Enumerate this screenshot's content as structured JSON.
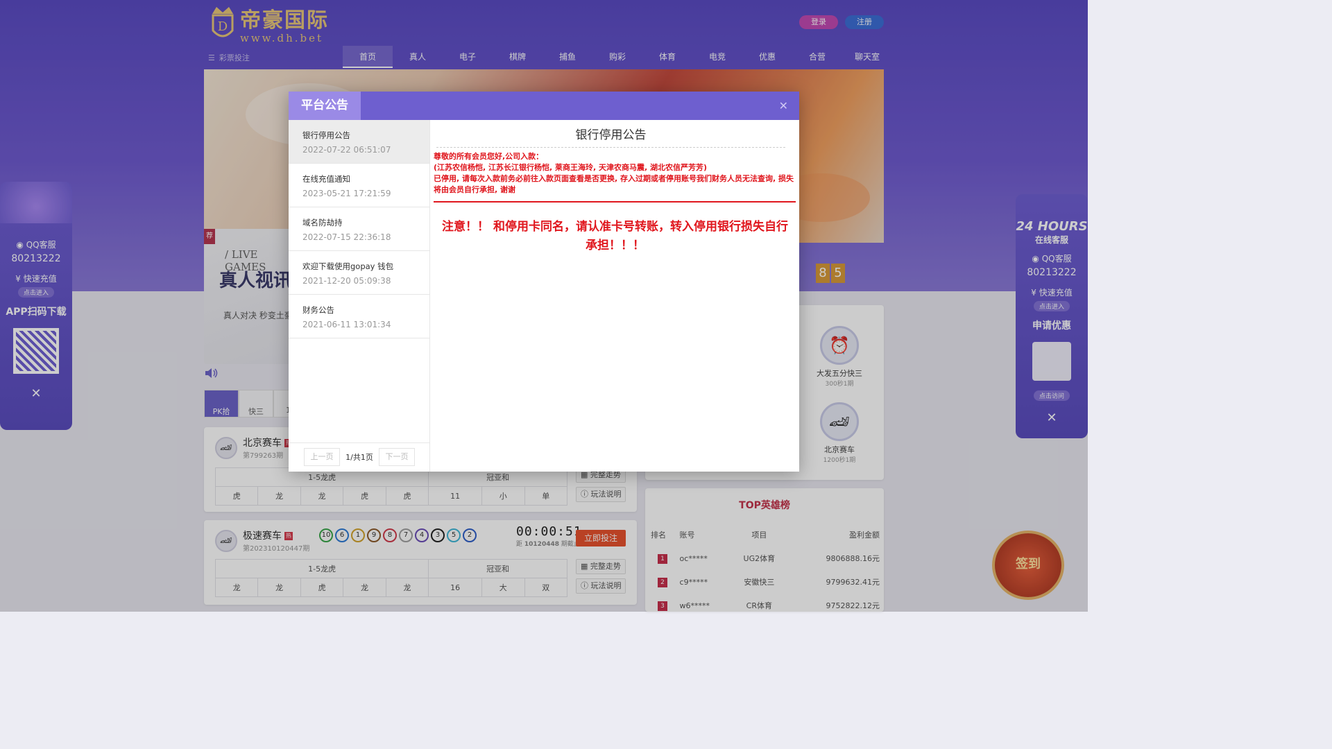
{
  "header": {
    "logo_cn": "帝豪国际",
    "logo_url": "www.dh.bet",
    "login": "登录",
    "register": "注册",
    "lottery_menu": "彩票投注",
    "nav": [
      "首页",
      "真人",
      "电子",
      "棋牌",
      "捕鱼",
      "购彩",
      "体育",
      "电竞",
      "优惠",
      "合营",
      "聊天室"
    ]
  },
  "live": {
    "rec": "荐",
    "sub": "/ LIVE GAMES",
    "title": "真人视讯",
    "desc": "真人对决 秒变土豪"
  },
  "cat_tabs": [
    "PK拾",
    "快三",
    "11"
  ],
  "games": [
    {
      "name": "北京赛车",
      "tag": "热",
      "period": "第799263期",
      "head": [
        "1-5龙虎",
        "冠亚和"
      ],
      "cells": [
        "虎",
        "龙",
        "龙",
        "虎",
        "虎",
        "11",
        "小",
        "单"
      ],
      "side": [
        "完整走势",
        "玩法说明"
      ]
    },
    {
      "name": "极速赛车",
      "tag": "热",
      "period": "第202310120447期",
      "balls": [
        "10",
        "6",
        "1",
        "9",
        "8",
        "7",
        "4",
        "3",
        "5",
        "2"
      ],
      "timer": "00:00:51",
      "timer_label": "距",
      "timer_period": "10120448",
      "timer_suffix": "期截止剩",
      "bet": "立即投注",
      "head": [
        "1-5龙虎",
        "冠亚和"
      ],
      "cells": [
        "龙",
        "龙",
        "虎",
        "龙",
        "龙",
        "16",
        "大",
        "双"
      ],
      "side": [
        "完整走势",
        "玩法说明"
      ]
    }
  ],
  "digits": [
    "8",
    "5"
  ],
  "right_games": [
    {
      "name": "大发五分快三",
      "sub": "300秒1期"
    },
    {
      "name": "北京赛车",
      "sub": "1200秒1期"
    }
  ],
  "top": {
    "title": "TOP英雄榜",
    "headers": [
      "排名",
      "账号",
      "项目",
      "盈利金额"
    ],
    "rows": [
      {
        "rank": "1",
        "account": "oc*****",
        "item": "UG2体育",
        "amount": "9806888.16元"
      },
      {
        "rank": "2",
        "account": "c9*****",
        "item": "安徽快三",
        "amount": "9799632.41元"
      },
      {
        "rank": "3",
        "account": "w6*****",
        "item": "CR体育",
        "amount": "9752822.12元"
      }
    ]
  },
  "left_float": {
    "qq_label": "QQ客服",
    "qq_num": "80213222",
    "charge": "快速充值",
    "enter": "点击进入",
    "app": "APP扫码下载"
  },
  "right_float": {
    "hours": "24 HOURS",
    "service": "在线客服",
    "qq_label": "QQ客服",
    "qq_num": "80213222",
    "charge": "快速充值",
    "enter": "点击进入",
    "promo": "申请优惠",
    "visit": "点击访问"
  },
  "sign": "签到",
  "modal": {
    "title": "平台公告",
    "list": [
      {
        "title": "银行停用公告",
        "date": "2022-07-22 06:51:07"
      },
      {
        "title": "在线充值通知",
        "date": "2023-05-21 17:21:59"
      },
      {
        "title": "域名防劫持",
        "date": "2022-07-15 22:36:18"
      },
      {
        "title": "欢迎下载使用gopay 钱包",
        "date": "2021-12-20 05:09:38"
      },
      {
        "title": "财务公告",
        "date": "2021-06-11 13:01:34"
      }
    ],
    "prev": "上一页",
    "page": "1/共1页",
    "next": "下一页",
    "body_title": "银行停用公告",
    "body_lines": [
      "尊敬的所有会员您好,公司入款：",
      "(江苏农信杨恺, 江苏长江银行杨恺, 莱商王海玲, 天津农商马震, 湖北农信严芳芳)",
      "已停用, 请每次入款前务必前往入款页面查看是否更换, 存入过期或者停用账号我们财务人员无法查询, 损失将由会员自行承担, 谢谢"
    ],
    "warning": "注意！！ 和停用卡同名，请认准卡号转账，转入停用银行损失自行承担！！！"
  }
}
